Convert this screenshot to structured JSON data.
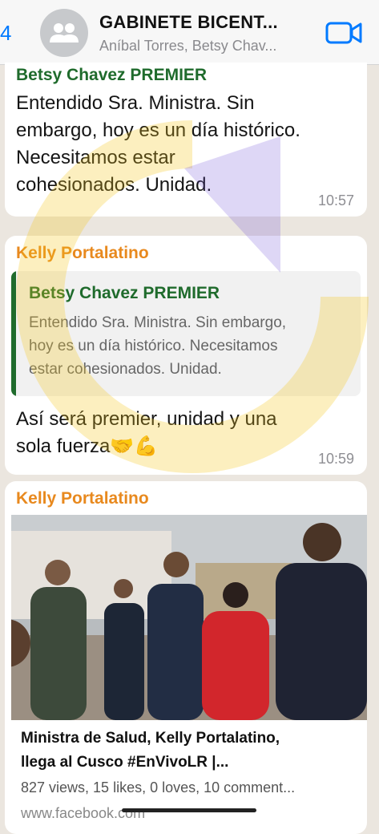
{
  "header": {
    "back_count": "4",
    "title": "GABINETE BICENT...",
    "subtitle": "Aníbal Torres, Betsy Chav..."
  },
  "messages": [
    {
      "sender": "Betsy Chavez PREMIER",
      "sender_color": "#1f6b2c",
      "lines": [
        "Entendido Sra. Ministra. Sin",
        "embargo, hoy es un día histórico.",
        "Necesitamos estar",
        "cohesionados. Unidad."
      ],
      "time": "10:57"
    },
    {
      "sender": "Kelly Portalatino",
      "sender_color": "#e8891e",
      "quote": {
        "sender": "Betsy Chavez PREMIER",
        "lines": [
          "Entendido Sra. Ministra. Sin embargo,",
          "hoy es un día histórico. Necesitamos",
          "estar cohesionados. Unidad."
        ]
      },
      "lines": [
        "Así será premier, unidad y una",
        "sola fuerza🤝💪"
      ],
      "time": "10:59"
    },
    {
      "sender": "Kelly Portalatino",
      "sender_color": "#e8891e",
      "link": {
        "title_lines": [
          "Ministra de Salud, Kelly Portalatino,",
          "llega al Cusco #EnVivoLR |..."
        ],
        "stats": "827 views, 15 likes, 0 loves, 10 comment...",
        "domain": "www.facebook.com"
      }
    }
  ],
  "colors": {
    "accent": "#007aff",
    "background": "#ebe6df"
  },
  "icons": [
    "group-avatar-icon",
    "video-call-icon"
  ]
}
